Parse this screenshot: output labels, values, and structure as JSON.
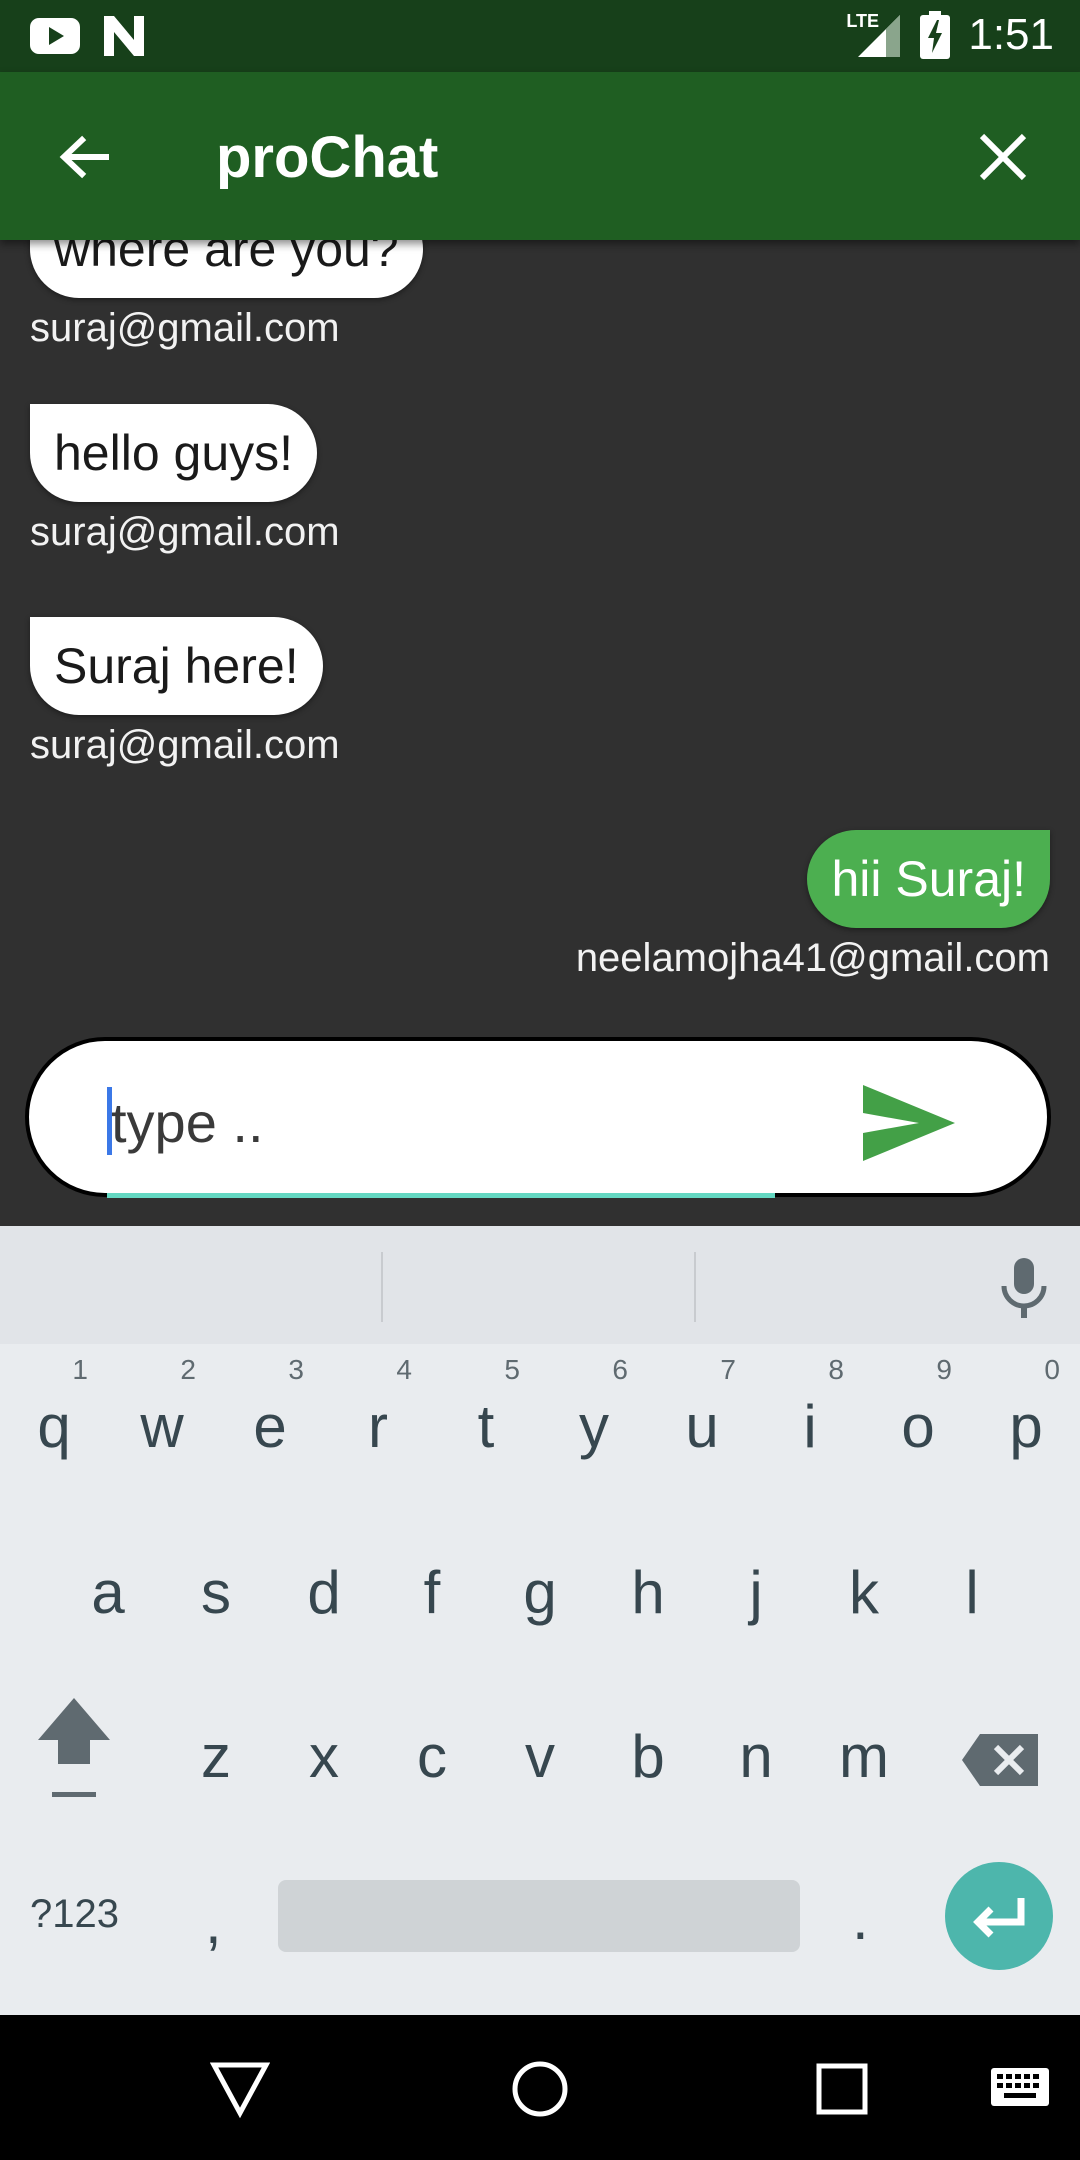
{
  "status_bar": {
    "time": "1:51",
    "network": "LTE",
    "icons": [
      "youtube-icon",
      "n-icon",
      "signal-icon",
      "battery-charging-icon"
    ]
  },
  "app_bar": {
    "title": "proChat",
    "back_icon": "arrow-left-icon",
    "close_icon": "close-icon"
  },
  "messages": [
    {
      "text": "where are you?",
      "sender": "suraj@gmail.com",
      "mine": false
    },
    {
      "text": "hello guys!",
      "sender": "suraj@gmail.com",
      "mine": false
    },
    {
      "text": "Suraj here!",
      "sender": "suraj@gmail.com",
      "mine": false
    },
    {
      "text": "hii Suraj!",
      "sender": "neelamojha41@gmail.com",
      "mine": true
    }
  ],
  "composer": {
    "placeholder": "type ..",
    "send_icon": "send-icon"
  },
  "colors": {
    "status_bar": "#17401a",
    "app_bar": "#1f5e22",
    "chat_bg": "#303030",
    "my_bubble": "#4caf50",
    "other_bubble": "#ffffff",
    "enter_key": "#4db6ac",
    "input_underline": "#64d8c2"
  },
  "keyboard": {
    "row1": [
      {
        "key": "q",
        "hint": "1"
      },
      {
        "key": "w",
        "hint": "2"
      },
      {
        "key": "e",
        "hint": "3"
      },
      {
        "key": "r",
        "hint": "4"
      },
      {
        "key": "t",
        "hint": "5"
      },
      {
        "key": "y",
        "hint": "6"
      },
      {
        "key": "u",
        "hint": "7"
      },
      {
        "key": "i",
        "hint": "8"
      },
      {
        "key": "o",
        "hint": "9"
      },
      {
        "key": "p",
        "hint": "0"
      }
    ],
    "row2": [
      "a",
      "s",
      "d",
      "f",
      "g",
      "h",
      "j",
      "k",
      "l"
    ],
    "row3": [
      "z",
      "x",
      "c",
      "v",
      "b",
      "n",
      "m"
    ],
    "symbols_label": "?123",
    "comma": ",",
    "period": "."
  },
  "nav_bar": {
    "icons": [
      "back-triangle-icon",
      "home-circle-icon",
      "recents-square-icon",
      "keyboard-icon"
    ]
  }
}
